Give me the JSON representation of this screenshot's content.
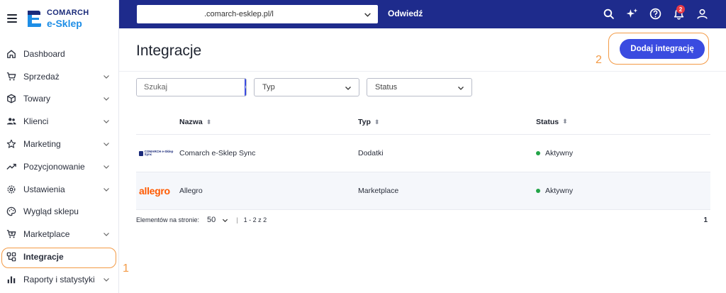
{
  "brand": {
    "company": "COMARCH",
    "product": "e-Sklep"
  },
  "topbar": {
    "url_value": ".comarch-esklep.pl/l",
    "visit_label": "Odwiedź",
    "notification_count": "2",
    "bg_color": "#1e2b8c"
  },
  "sidebar": {
    "items": [
      {
        "label": "Dashboard",
        "icon": "home-icon",
        "has_chevron": false
      },
      {
        "label": "Sprzedaż",
        "icon": "cart-icon",
        "has_chevron": true
      },
      {
        "label": "Towary",
        "icon": "box-icon",
        "has_chevron": true
      },
      {
        "label": "Klienci",
        "icon": "users-icon",
        "has_chevron": true
      },
      {
        "label": "Marketing",
        "icon": "star-icon",
        "has_chevron": true
      },
      {
        "label": "Pozycjonowanie",
        "icon": "trend-icon",
        "has_chevron": true
      },
      {
        "label": "Ustawienia",
        "icon": "gear-icon",
        "has_chevron": true
      },
      {
        "label": "Wygląd sklepu",
        "icon": "palette-icon",
        "has_chevron": false
      },
      {
        "label": "Marketplace",
        "icon": "cart-plus-icon",
        "has_chevron": true
      },
      {
        "label": "Integracje",
        "icon": "integration-icon",
        "has_chevron": false,
        "active": true
      },
      {
        "label": "Raporty i statystyki",
        "icon": "bar-chart-icon",
        "has_chevron": true
      }
    ]
  },
  "main": {
    "title": "Integracje",
    "add_button": "Dodaj integrację",
    "annotation_sidebar": "1",
    "annotation_button": "2",
    "accent_color": "#3a4be0",
    "highlight_color": "#f39a45"
  },
  "filters": {
    "search_placeholder": "Szukaj",
    "type_label": "Typ",
    "status_label": "Status"
  },
  "table": {
    "columns": {
      "name": "Nazwa",
      "type": "Typ",
      "status": "Status"
    },
    "rows": [
      {
        "logo": "comarch-logo",
        "logo_text": "COMARCH e-Sklep Sync",
        "name": "Comarch e-Sklep Sync",
        "type": "Dodatki",
        "status": "Aktywny"
      },
      {
        "logo": "allegro-logo",
        "logo_text": "allegro",
        "name": "Allegro",
        "type": "Marketplace",
        "status": "Aktywny"
      }
    ]
  },
  "pager": {
    "per_page_label": "Elementów na stronie:",
    "per_page_value": "50",
    "range": "1 - 2 z 2",
    "current_page": "1"
  }
}
